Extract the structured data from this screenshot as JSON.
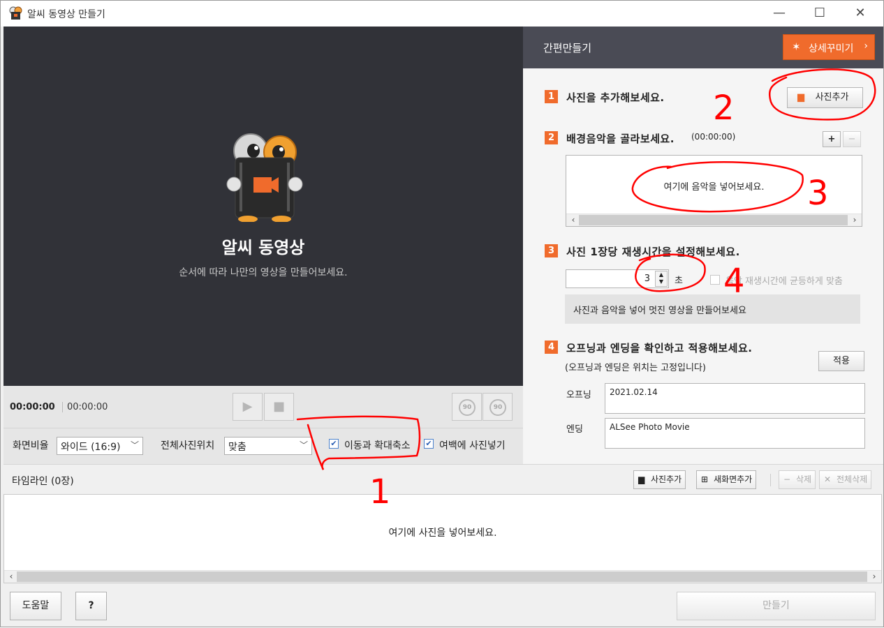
{
  "window": {
    "title": "알씨 동영상 만들기"
  },
  "preview": {
    "app_name": "알씨 동영상",
    "subtitle": "순서에 따라 나만의 영상을 만들어보세요."
  },
  "playback": {
    "current_time": "00:00:00",
    "total_time": "00:00:00",
    "rotate_left": "90",
    "rotate_right": "90"
  },
  "options": {
    "ratio_label": "화면비율",
    "ratio_value": "와이드 (16:9)",
    "position_label": "전체사진위치",
    "position_value": "맞춤",
    "motion_zoom_label": "이동과 확대축소",
    "motion_zoom_checked": true,
    "margin_photo_label": "여백에 사진넣기",
    "margin_photo_checked": true
  },
  "panel": {
    "title": "간편만들기",
    "detail_button": "상세꾸미기",
    "step1": {
      "num": "1",
      "title": "사진을 추가해보세요.",
      "add_button": "사진추가"
    },
    "step2": {
      "num": "2",
      "title": "배경음악을 골라보세요.",
      "duration": "(00:00:00)",
      "drop_msg": "여기에 음악을 넣어보세요."
    },
    "step3": {
      "num": "3",
      "title": "사진 1장당 재생시간을 설정해보세요.",
      "seconds": "3",
      "unit": "초",
      "fit_label": "음악 재생시간에 균등하게 맞춤",
      "hint": "사진과 음악을 넣어 멋진 영상을 만들어보세요"
    },
    "step4": {
      "num": "4",
      "title": "오프닝과 엔딩을 확인하고 적용해보세요.",
      "note": "(오프닝과 엔딩은 위치는 고정입니다)",
      "apply_button": "적용",
      "opening_label": "오프닝",
      "opening_value": "2021.02.14",
      "ending_label": "엔딩",
      "ending_value": "ALSee Photo Movie"
    }
  },
  "timeline": {
    "title": "타임라인 (0장)",
    "add_photo": "사진추가",
    "add_screen": "새화면추가",
    "delete": "삭제",
    "delete_all": "전체삭제",
    "drop_msg": "여기에 사진을 넣어보세요."
  },
  "footer": {
    "help": "도움말",
    "question": "?",
    "make": "만들기"
  },
  "annotations": [
    "2",
    "3",
    "4",
    "1"
  ]
}
